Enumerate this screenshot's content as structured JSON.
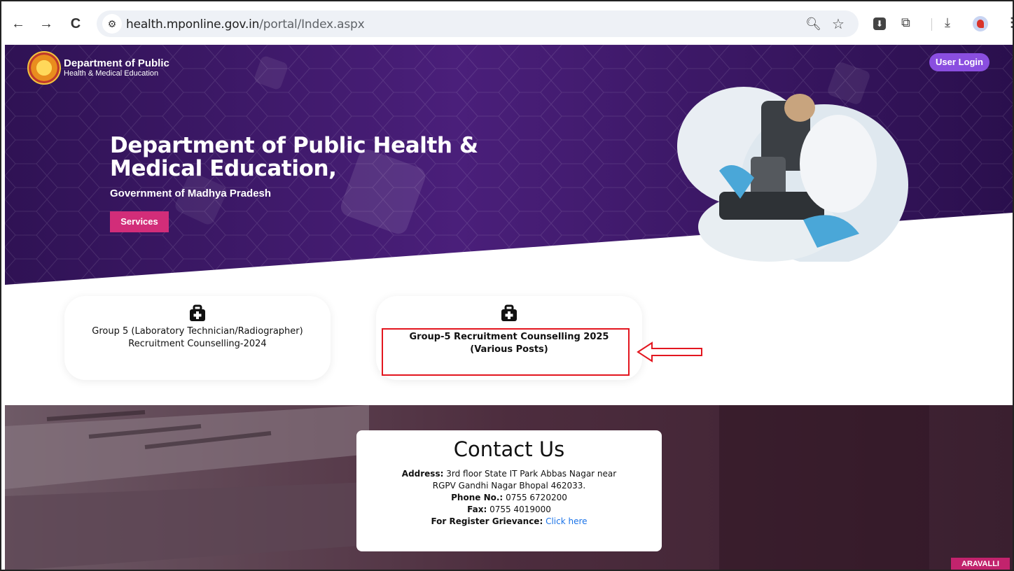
{
  "browser": {
    "url_host": "health.mponline.gov.in",
    "url_path": "/portal/Index.aspx",
    "back_icon": "←",
    "forward_icon": "→",
    "reload_icon": "C"
  },
  "brand": {
    "line1": "Department of Public",
    "line2": "Health & Medical Education"
  },
  "header": {
    "login_label": "User Login"
  },
  "hero": {
    "title": "Department of Public Health & Medical Education,",
    "subtitle": "Government of Madhya Pradesh",
    "services_label": "Services"
  },
  "cards": [
    {
      "label": "Group 5 (Laboratory Technician/Radiographer) Recruitment Counselling-2024"
    },
    {
      "label": "Group-5 Recruitment Counselling 2025 (Various Posts)"
    }
  ],
  "contact": {
    "title": "Contact Us",
    "address_label": "Address:",
    "address": "3rd floor State IT Park Abbas Nagar near RGPV Gandhi Nagar Bhopal 462033.",
    "phone_label": "Phone No.:",
    "phone": "0755 6720200",
    "fax_label": "Fax:",
    "fax": "0755 4019000",
    "grievance_label": "For Register Grievance:",
    "grievance_link": "Click here"
  },
  "footer_badge": "ARAVALLI",
  "colors": {
    "hero_purple": "#3a1a6e",
    "accent_pink": "#d22d79",
    "login_purple": "#8a4ee0",
    "highlight_red": "#e3161f"
  }
}
